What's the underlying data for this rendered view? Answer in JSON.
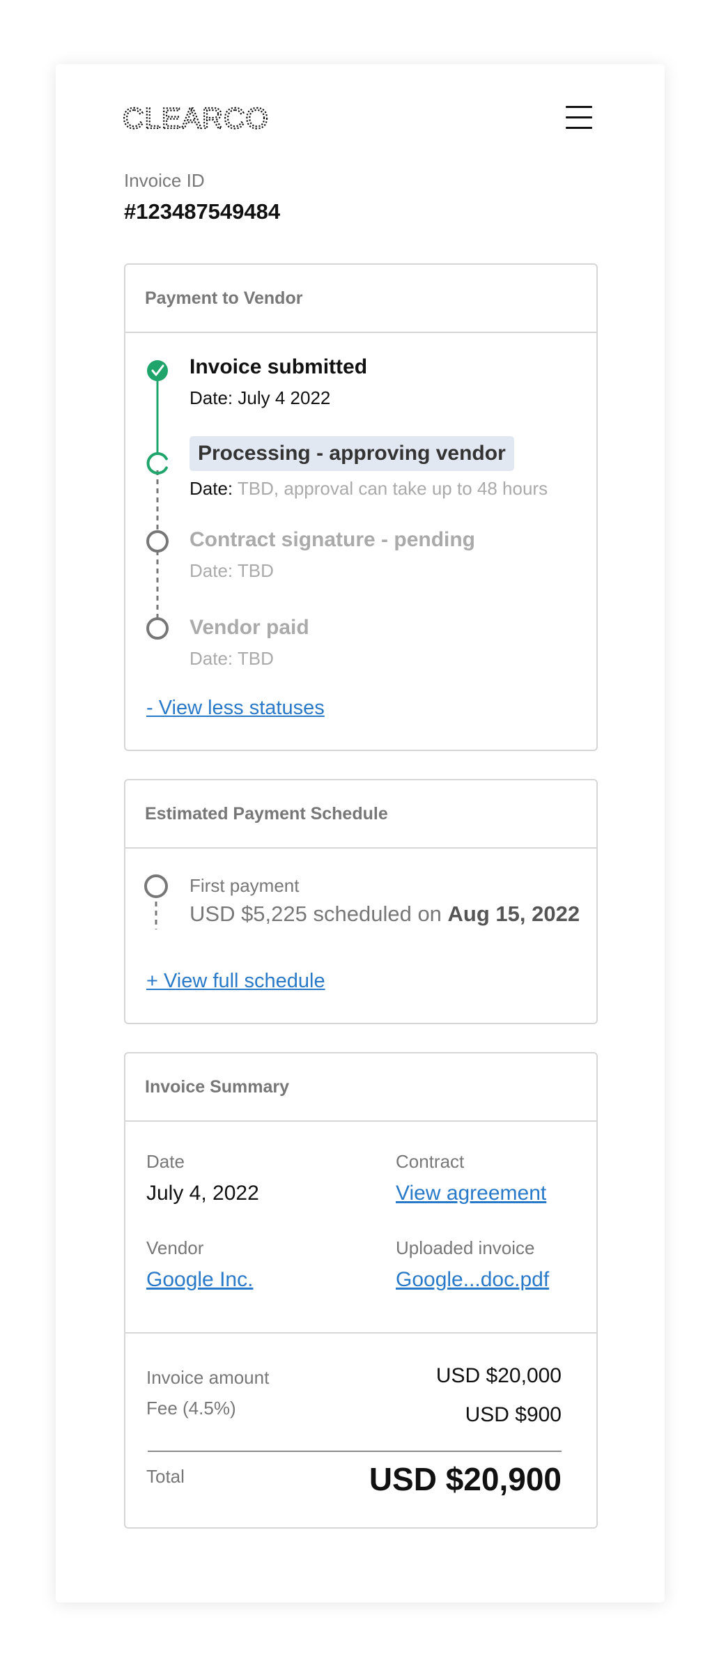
{
  "brand": {
    "logo_text": "CLEARCO"
  },
  "header": {
    "menu_icon": "hamburger-menu-icon"
  },
  "invoice": {
    "id_label": "Invoice ID",
    "id_value": "#123487549484"
  },
  "payment_to_vendor": {
    "title": "Payment to Vendor",
    "steps": [
      {
        "title": "Invoice submitted",
        "date_label": "Date:",
        "date_value": "July 4 2022",
        "status": "complete"
      },
      {
        "title": "Processing - approving vendor",
        "date_label": "Date:",
        "date_value": "TBD, approval can take up to 48 hours",
        "status": "in-progress"
      },
      {
        "title": "Contract signature - pending",
        "date_label": "Date:",
        "date_value": "TBD",
        "status": "pending"
      },
      {
        "title": "Vendor paid",
        "date_label": "Date:",
        "date_value": "TBD",
        "status": "pending"
      }
    ],
    "toggle_link": "- View less statuses",
    "colors": {
      "complete": "#1fa56b",
      "pending": "#777777"
    }
  },
  "payment_schedule": {
    "title": "Estimated Payment Schedule",
    "first_label": "First payment",
    "first_amount_text": "USD $5,225 scheduled on",
    "first_date": "Aug 15, 2022",
    "view_link": "+ View full schedule"
  },
  "summary": {
    "title": "Invoice Summary",
    "date_label": "Date",
    "date_value": "July 4, 2022",
    "contract_label": "Contract",
    "contract_link": "View agreement",
    "vendor_label": "Vendor",
    "vendor_link": "Google Inc.",
    "uploaded_label": "Uploaded invoice",
    "uploaded_link": "Google...doc.pdf",
    "amount_label": "Invoice amount",
    "amount_value": "USD $20,000",
    "fee_label": "Fee (4.5%)",
    "fee_value": "USD $900",
    "total_label": "Total",
    "total_value": "USD $20,900"
  },
  "theme": {
    "link_color": "#2979c9",
    "accent_green": "#1fa56b"
  }
}
